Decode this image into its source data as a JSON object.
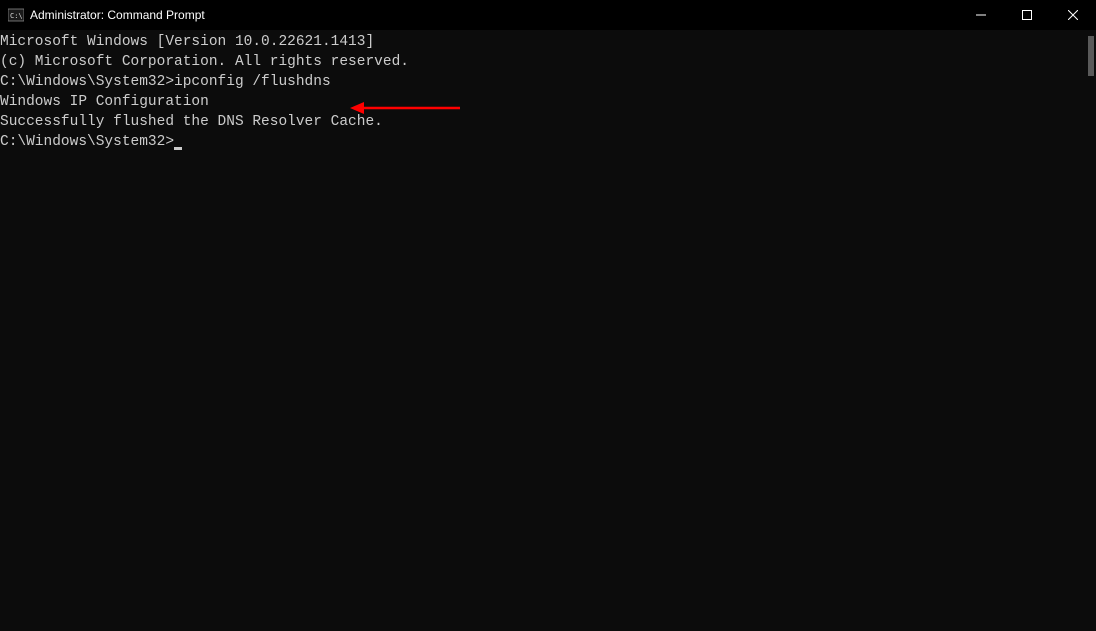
{
  "titlebar": {
    "title": "Administrator: Command Prompt"
  },
  "terminal": {
    "lines": [
      "Microsoft Windows [Version 10.0.22621.1413]",
      "(c) Microsoft Corporation. All rights reserved.",
      "",
      "C:\\Windows\\System32>ipconfig /flushdns",
      "",
      "Windows IP Configuration",
      "",
      "Successfully flushed the DNS Resolver Cache.",
      "",
      "C:\\Windows\\System32>"
    ],
    "prompt_path": "C:\\Windows\\System32>",
    "command": "ipconfig /flushdns",
    "version_line": "Microsoft Windows [Version 10.0.22621.1413]",
    "copyright_line": "(c) Microsoft Corporation. All rights reserved.",
    "config_header": "Windows IP Configuration",
    "result_line": "Successfully flushed the DNS Resolver Cache."
  },
  "annotation": {
    "color": "#ff0000"
  }
}
